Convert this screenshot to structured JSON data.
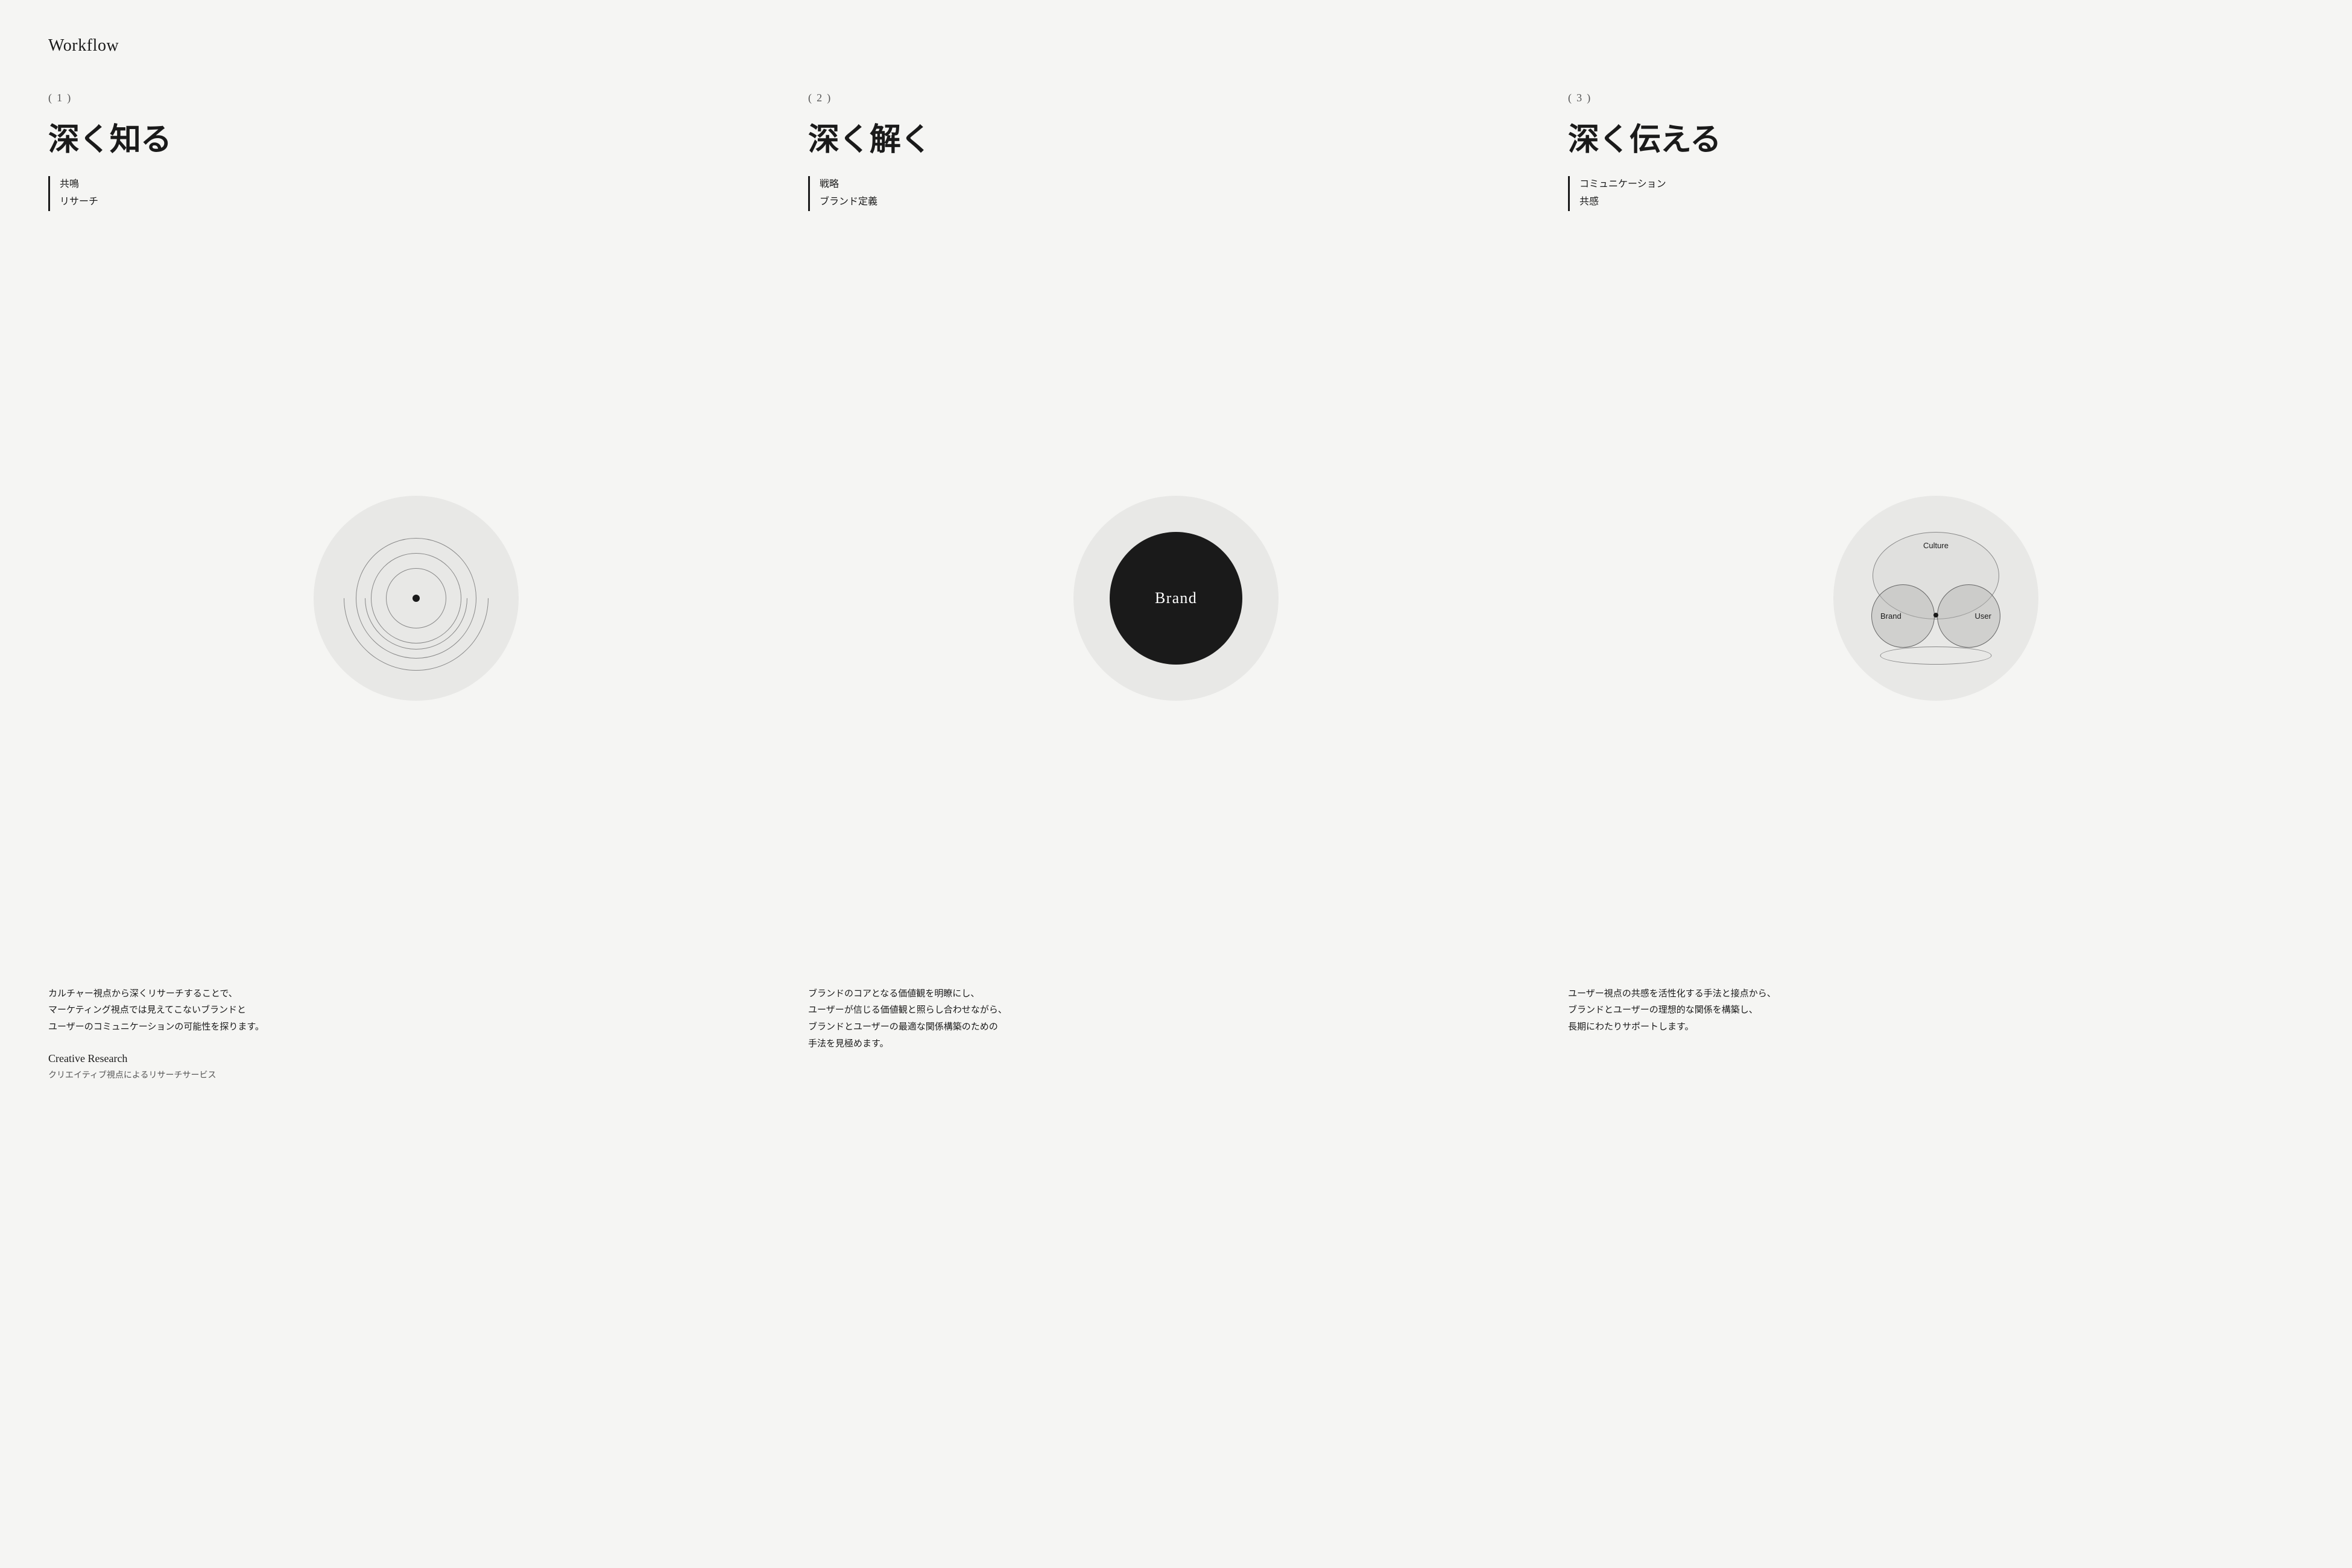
{
  "page": {
    "title": "Workflow"
  },
  "steps": [
    {
      "number": "( 1 )",
      "title": "深く知る",
      "tags": [
        "共鳴",
        "リサーチ"
      ],
      "description": "カルチャー視点から深くリサーチすることで、\nマーケティング視点では見えてこないブランドと\nユーザーのコミュニケーションの可能性を探ります。",
      "service_title": "Creative Research",
      "service_subtitle": "クリエイティブ視点によるリサーチサービス"
    },
    {
      "number": "( 2 )",
      "title": "深く解く",
      "tags": [
        "戦略",
        "ブランド定義"
      ],
      "description": "ブランドのコアとなる価値観を明瞭にし、\nユーザーが信じる価値観と照らし合わせながら、\nブランドとユーザーの最適な関係構築のための\n手法を見極めます。",
      "service_title": "",
      "service_subtitle": ""
    },
    {
      "number": "( 3 )",
      "title": "深く伝える",
      "tags": [
        "コミュニケーション",
        "共感"
      ],
      "description": "ユーザー視点の共感を活性化する手法と接点から、\nブランドとユーザーの理想的な関係を構築し、\n長期にわたりサポートします。",
      "service_title": "",
      "service_subtitle": ""
    }
  ],
  "diagrams": {
    "diagram1": {
      "type": "concentric"
    },
    "diagram2": {
      "type": "brand-circle",
      "label": "Brand"
    },
    "diagram3": {
      "type": "venn",
      "culture_label": "Culture",
      "brand_label": "Brand",
      "user_label": "User"
    }
  }
}
